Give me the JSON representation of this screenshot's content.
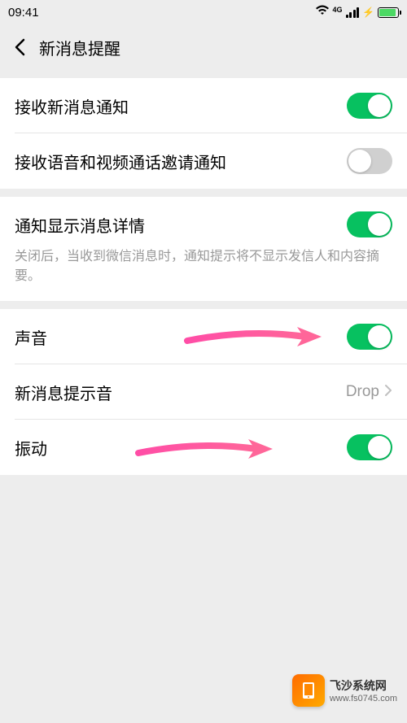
{
  "statusBar": {
    "time": "09:41",
    "networkLabel": "4G"
  },
  "header": {
    "title": "新消息提醒"
  },
  "group1": {
    "receiveNewMsg": {
      "label": "接收新消息通知",
      "on": true
    },
    "receiveVoiceVideo": {
      "label": "接收语音和视频通话邀请通知",
      "on": false
    }
  },
  "group2": {
    "showDetail": {
      "label": "通知显示消息详情",
      "on": true
    },
    "showDetailDesc": "关闭后，当收到微信消息时，通知提示将不显示发信人和内容摘要。"
  },
  "group3": {
    "sound": {
      "label": "声音",
      "on": true
    },
    "ringtone": {
      "label": "新消息提示音",
      "value": "Drop"
    },
    "vibrate": {
      "label": "振动",
      "on": true
    }
  },
  "watermark": {
    "title": "飞沙系统网",
    "url": "www.fs0745.com"
  }
}
